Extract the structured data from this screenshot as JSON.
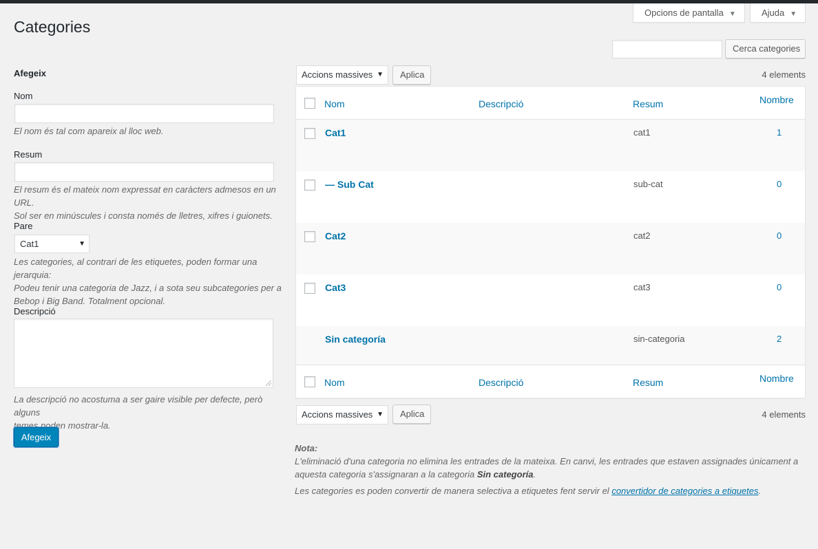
{
  "header": {
    "screen_options": "Opcions de pantalla",
    "help": "Ajuda",
    "page_title": "Categories",
    "search_button": "Cerca categories",
    "search_placeholder": ""
  },
  "form": {
    "title": "Afegeix",
    "name_label": "Nom",
    "name_value": "",
    "name_help": "El nom és tal com apareix al lloc web.",
    "slug_label": "Resum",
    "slug_value": "",
    "slug_help_1": "El resum és el mateix nom expressat en caràcters admesos en un URL.",
    "slug_help_2": "Sol ser en minúscules i consta només de lletres, xifres i guionets.",
    "parent_label": "Pare",
    "parent_selected": "Cat1",
    "parent_help_1": "Les categories, al contrari de les etiquetes, poden formar una jerarquia:",
    "parent_help_2": "Podeu tenir una categoria de Jazz, i a sota seu subcategories per a",
    "parent_help_3": "Bebop i Big Band. Totalment opcional.",
    "desc_label": "Descripció",
    "desc_value": "",
    "desc_help_1": "La descripció no acostuma a ser gaire visible per defecte, però alguns",
    "desc_help_2": "temes poden mostrar-la.",
    "submit": "Afegeix"
  },
  "tablenav": {
    "bulk_label": "Accions massives",
    "apply": "Aplica",
    "count": "4 elements"
  },
  "table": {
    "columns": {
      "name": "Nom",
      "description": "Descripció",
      "slug": "Resum",
      "count": "Nombre"
    },
    "rows": [
      {
        "name": "Cat1",
        "slug": "cat1",
        "count": "1"
      },
      {
        "name": "— Sub Cat",
        "slug": "sub-cat",
        "count": "0"
      },
      {
        "name": "Cat2",
        "slug": "cat2",
        "count": "0"
      },
      {
        "name": "Cat3",
        "slug": "cat3",
        "count": "0"
      },
      {
        "name": "Sin categoría",
        "slug": "sin-categoria",
        "count": "2"
      }
    ]
  },
  "note": {
    "title": "Nota:",
    "line1": "L'eliminació d'una categoria no elimina les entrades de la mateixa. En canvi, les entrades que estaven assignades únicament a",
    "line2_pre": "aquesta categoria s'assignaran a la categoria ",
    "line2_bold": "Sin categoría",
    "line2_post": ".",
    "line3_pre": "Les categories es poden convertir de manera selectiva a etiquetes fent servir el ",
    "line3_link": "convertidor de categories a etiquetes",
    "line3_post": "."
  },
  "colors": {
    "link": "#0073aa",
    "primary": "#0085ba",
    "background": "#f1f1f1"
  }
}
